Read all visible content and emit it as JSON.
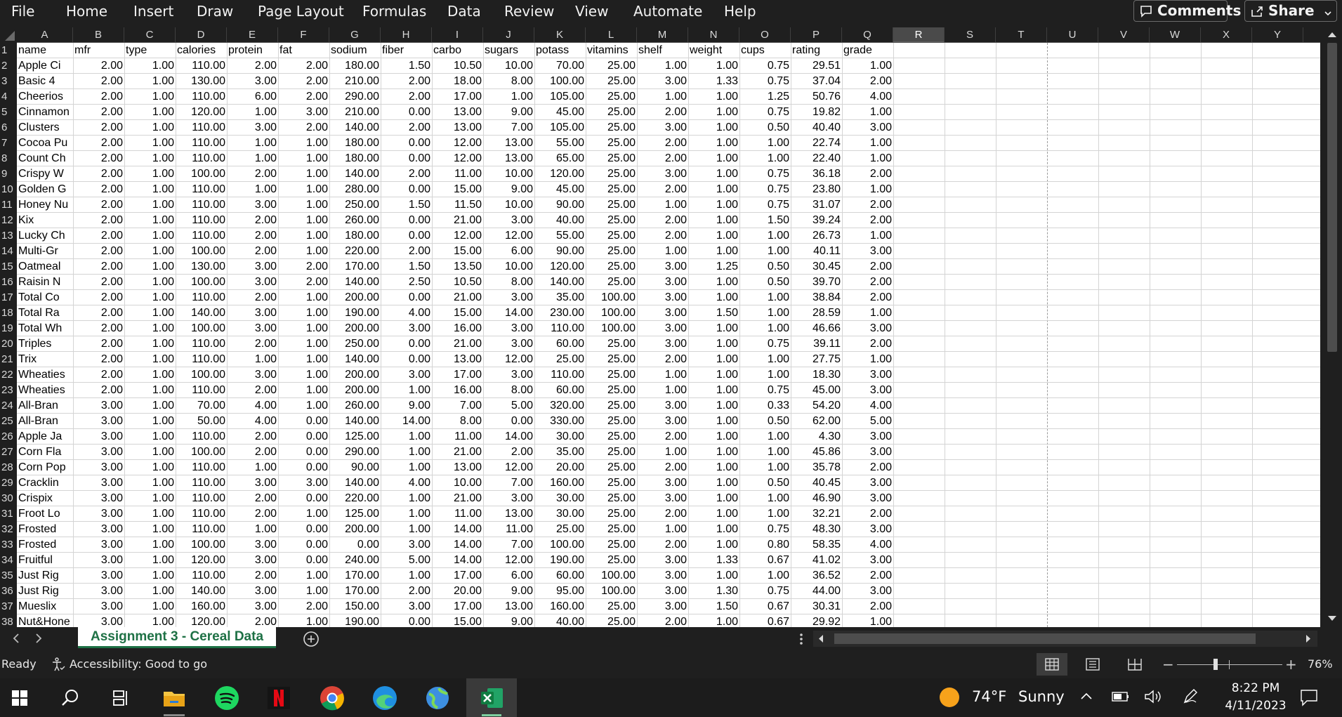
{
  "ribbon": {
    "tabs": [
      "File",
      "Home",
      "Insert",
      "Draw",
      "Page Layout",
      "Formulas",
      "Data",
      "Review",
      "View",
      "Automate",
      "Help"
    ],
    "comments_label": "Comments",
    "share_label": "Share"
  },
  "columns": [
    "A",
    "B",
    "C",
    "D",
    "E",
    "F",
    "G",
    "H",
    "I",
    "J",
    "K",
    "L",
    "M",
    "N",
    "O",
    "P",
    "Q",
    "R",
    "S",
    "T",
    "U",
    "V",
    "W",
    "X",
    "Y"
  ],
  "selected_column": "R",
  "headers": [
    "name",
    "mfr",
    "type",
    "calories",
    "protein",
    "fat",
    "sodium",
    "fiber",
    "carbo",
    "sugars",
    "potass",
    "vitamins",
    "shelf",
    "weight",
    "cups",
    "rating",
    "grade"
  ],
  "rows": [
    [
      "Apple Ci",
      "2.00",
      "1.00",
      "110.00",
      "2.00",
      "2.00",
      "180.00",
      "1.50",
      "10.50",
      "10.00",
      "70.00",
      "25.00",
      "1.00",
      "1.00",
      "0.75",
      "29.51",
      "1.00"
    ],
    [
      "Basic 4",
      "2.00",
      "1.00",
      "130.00",
      "3.00",
      "2.00",
      "210.00",
      "2.00",
      "18.00",
      "8.00",
      "100.00",
      "25.00",
      "3.00",
      "1.33",
      "0.75",
      "37.04",
      "2.00"
    ],
    [
      "Cheerios",
      "2.00",
      "1.00",
      "110.00",
      "6.00",
      "2.00",
      "290.00",
      "2.00",
      "17.00",
      "1.00",
      "105.00",
      "25.00",
      "1.00",
      "1.00",
      "1.25",
      "50.76",
      "4.00"
    ],
    [
      "Cinnamon",
      "2.00",
      "1.00",
      "120.00",
      "1.00",
      "3.00",
      "210.00",
      "0.00",
      "13.00",
      "9.00",
      "45.00",
      "25.00",
      "2.00",
      "1.00",
      "0.75",
      "19.82",
      "1.00"
    ],
    [
      "Clusters",
      "2.00",
      "1.00",
      "110.00",
      "3.00",
      "2.00",
      "140.00",
      "2.00",
      "13.00",
      "7.00",
      "105.00",
      "25.00",
      "3.00",
      "1.00",
      "0.50",
      "40.40",
      "3.00"
    ],
    [
      "Cocoa Pu",
      "2.00",
      "1.00",
      "110.00",
      "1.00",
      "1.00",
      "180.00",
      "0.00",
      "12.00",
      "13.00",
      "55.00",
      "25.00",
      "2.00",
      "1.00",
      "1.00",
      "22.74",
      "1.00"
    ],
    [
      "Count Ch",
      "2.00",
      "1.00",
      "110.00",
      "1.00",
      "1.00",
      "180.00",
      "0.00",
      "12.00",
      "13.00",
      "65.00",
      "25.00",
      "2.00",
      "1.00",
      "1.00",
      "22.40",
      "1.00"
    ],
    [
      "Crispy W",
      "2.00",
      "1.00",
      "100.00",
      "2.00",
      "1.00",
      "140.00",
      "2.00",
      "11.00",
      "10.00",
      "120.00",
      "25.00",
      "3.00",
      "1.00",
      "0.75",
      "36.18",
      "2.00"
    ],
    [
      "Golden G",
      "2.00",
      "1.00",
      "110.00",
      "1.00",
      "1.00",
      "280.00",
      "0.00",
      "15.00",
      "9.00",
      "45.00",
      "25.00",
      "2.00",
      "1.00",
      "0.75",
      "23.80",
      "1.00"
    ],
    [
      "Honey Nu",
      "2.00",
      "1.00",
      "110.00",
      "3.00",
      "1.00",
      "250.00",
      "1.50",
      "11.50",
      "10.00",
      "90.00",
      "25.00",
      "1.00",
      "1.00",
      "0.75",
      "31.07",
      "2.00"
    ],
    [
      "Kix",
      "2.00",
      "1.00",
      "110.00",
      "2.00",
      "1.00",
      "260.00",
      "0.00",
      "21.00",
      "3.00",
      "40.00",
      "25.00",
      "2.00",
      "1.00",
      "1.50",
      "39.24",
      "2.00"
    ],
    [
      "Lucky Ch",
      "2.00",
      "1.00",
      "110.00",
      "2.00",
      "1.00",
      "180.00",
      "0.00",
      "12.00",
      "12.00",
      "55.00",
      "25.00",
      "2.00",
      "1.00",
      "1.00",
      "26.73",
      "1.00"
    ],
    [
      "Multi-Gr",
      "2.00",
      "1.00",
      "100.00",
      "2.00",
      "1.00",
      "220.00",
      "2.00",
      "15.00",
      "6.00",
      "90.00",
      "25.00",
      "1.00",
      "1.00",
      "1.00",
      "40.11",
      "3.00"
    ],
    [
      "Oatmeal",
      "2.00",
      "1.00",
      "130.00",
      "3.00",
      "2.00",
      "170.00",
      "1.50",
      "13.50",
      "10.00",
      "120.00",
      "25.00",
      "3.00",
      "1.25",
      "0.50",
      "30.45",
      "2.00"
    ],
    [
      "Raisin N",
      "2.00",
      "1.00",
      "100.00",
      "3.00",
      "2.00",
      "140.00",
      "2.50",
      "10.50",
      "8.00",
      "140.00",
      "25.00",
      "3.00",
      "1.00",
      "0.50",
      "39.70",
      "2.00"
    ],
    [
      "Total Co",
      "2.00",
      "1.00",
      "110.00",
      "2.00",
      "1.00",
      "200.00",
      "0.00",
      "21.00",
      "3.00",
      "35.00",
      "100.00",
      "3.00",
      "1.00",
      "1.00",
      "38.84",
      "2.00"
    ],
    [
      "Total Ra",
      "2.00",
      "1.00",
      "140.00",
      "3.00",
      "1.00",
      "190.00",
      "4.00",
      "15.00",
      "14.00",
      "230.00",
      "100.00",
      "3.00",
      "1.50",
      "1.00",
      "28.59",
      "1.00"
    ],
    [
      "Total Wh",
      "2.00",
      "1.00",
      "100.00",
      "3.00",
      "1.00",
      "200.00",
      "3.00",
      "16.00",
      "3.00",
      "110.00",
      "100.00",
      "3.00",
      "1.00",
      "1.00",
      "46.66",
      "3.00"
    ],
    [
      "Triples",
      "2.00",
      "1.00",
      "110.00",
      "2.00",
      "1.00",
      "250.00",
      "0.00",
      "21.00",
      "3.00",
      "60.00",
      "25.00",
      "3.00",
      "1.00",
      "0.75",
      "39.11",
      "2.00"
    ],
    [
      "Trix",
      "2.00",
      "1.00",
      "110.00",
      "1.00",
      "1.00",
      "140.00",
      "0.00",
      "13.00",
      "12.00",
      "25.00",
      "25.00",
      "2.00",
      "1.00",
      "1.00",
      "27.75",
      "1.00"
    ],
    [
      "Wheaties",
      "2.00",
      "1.00",
      "100.00",
      "3.00",
      "1.00",
      "200.00",
      "3.00",
      "17.00",
      "3.00",
      "110.00",
      "25.00",
      "1.00",
      "1.00",
      "1.00",
      "18.30",
      "3.00"
    ],
    [
      "Wheaties",
      "2.00",
      "1.00",
      "110.00",
      "2.00",
      "1.00",
      "200.00",
      "1.00",
      "16.00",
      "8.00",
      "60.00",
      "25.00",
      "1.00",
      "1.00",
      "0.75",
      "45.00",
      "3.00"
    ],
    [
      "All-Bran",
      "3.00",
      "1.00",
      "70.00",
      "4.00",
      "1.00",
      "260.00",
      "9.00",
      "7.00",
      "5.00",
      "320.00",
      "25.00",
      "3.00",
      "1.00",
      "0.33",
      "54.20",
      "4.00"
    ],
    [
      "All-Bran",
      "3.00",
      "1.00",
      "50.00",
      "4.00",
      "0.00",
      "140.00",
      "14.00",
      "8.00",
      "0.00",
      "330.00",
      "25.00",
      "3.00",
      "1.00",
      "0.50",
      "62.00",
      "5.00"
    ],
    [
      "Apple Ja",
      "3.00",
      "1.00",
      "110.00",
      "2.00",
      "0.00",
      "125.00",
      "1.00",
      "11.00",
      "14.00",
      "30.00",
      "25.00",
      "2.00",
      "1.00",
      "1.00",
      "4.30",
      "3.00"
    ],
    [
      "Corn Fla",
      "3.00",
      "1.00",
      "100.00",
      "2.00",
      "0.00",
      "290.00",
      "1.00",
      "21.00",
      "2.00",
      "35.00",
      "25.00",
      "1.00",
      "1.00",
      "1.00",
      "45.86",
      "3.00"
    ],
    [
      "Corn Pop",
      "3.00",
      "1.00",
      "110.00",
      "1.00",
      "0.00",
      "90.00",
      "1.00",
      "13.00",
      "12.00",
      "20.00",
      "25.00",
      "2.00",
      "1.00",
      "1.00",
      "35.78",
      "2.00"
    ],
    [
      "Cracklin",
      "3.00",
      "1.00",
      "110.00",
      "3.00",
      "3.00",
      "140.00",
      "4.00",
      "10.00",
      "7.00",
      "160.00",
      "25.00",
      "3.00",
      "1.00",
      "0.50",
      "40.45",
      "3.00"
    ],
    [
      "Crispix",
      "3.00",
      "1.00",
      "110.00",
      "2.00",
      "0.00",
      "220.00",
      "1.00",
      "21.00",
      "3.00",
      "30.00",
      "25.00",
      "3.00",
      "1.00",
      "1.00",
      "46.90",
      "3.00"
    ],
    [
      "Froot Lo",
      "3.00",
      "1.00",
      "110.00",
      "2.00",
      "1.00",
      "125.00",
      "1.00",
      "11.00",
      "13.00",
      "30.00",
      "25.00",
      "2.00",
      "1.00",
      "1.00",
      "32.21",
      "2.00"
    ],
    [
      "Frosted",
      "3.00",
      "1.00",
      "110.00",
      "1.00",
      "0.00",
      "200.00",
      "1.00",
      "14.00",
      "11.00",
      "25.00",
      "25.00",
      "1.00",
      "1.00",
      "0.75",
      "48.30",
      "3.00"
    ],
    [
      "Frosted",
      "3.00",
      "1.00",
      "100.00",
      "3.00",
      "0.00",
      "0.00",
      "3.00",
      "14.00",
      "7.00",
      "100.00",
      "25.00",
      "2.00",
      "1.00",
      "0.80",
      "58.35",
      "4.00"
    ],
    [
      "Fruitful",
      "3.00",
      "1.00",
      "120.00",
      "3.00",
      "0.00",
      "240.00",
      "5.00",
      "14.00",
      "12.00",
      "190.00",
      "25.00",
      "3.00",
      "1.33",
      "0.67",
      "41.02",
      "3.00"
    ],
    [
      "Just Rig",
      "3.00",
      "1.00",
      "110.00",
      "2.00",
      "1.00",
      "170.00",
      "1.00",
      "17.00",
      "6.00",
      "60.00",
      "100.00",
      "3.00",
      "1.00",
      "1.00",
      "36.52",
      "2.00"
    ],
    [
      "Just Rig",
      "3.00",
      "1.00",
      "140.00",
      "3.00",
      "1.00",
      "170.00",
      "2.00",
      "20.00",
      "9.00",
      "95.00",
      "100.00",
      "3.00",
      "1.30",
      "0.75",
      "44.00",
      "3.00"
    ],
    [
      "Mueslix",
      "3.00",
      "1.00",
      "160.00",
      "3.00",
      "2.00",
      "150.00",
      "3.00",
      "17.00",
      "13.00",
      "160.00",
      "25.00",
      "3.00",
      "1.50",
      "0.67",
      "30.31",
      "2.00"
    ],
    [
      "Nut&Hone",
      "3.00",
      "1.00",
      "120.00",
      "2.00",
      "1.00",
      "190.00",
      "0.00",
      "15.00",
      "9.00",
      "40.00",
      "25.00",
      "2.00",
      "1.00",
      "0.67",
      "29.92",
      "1.00"
    ]
  ],
  "sheet_tab": "Assignment 3 - Cereal Data",
  "status": {
    "ready": "Ready",
    "accessibility": "Accessibility: Good to go",
    "zoom": "76%",
    "zoom_level": 0.76
  },
  "taskbar": {
    "weather_temp": "74°F",
    "weather_text": "Sunny",
    "time": "8:22 PM",
    "date": "4/11/2023"
  },
  "colors": {
    "excel_green": "#1e7145",
    "dark_bg": "#1f1f1f"
  }
}
